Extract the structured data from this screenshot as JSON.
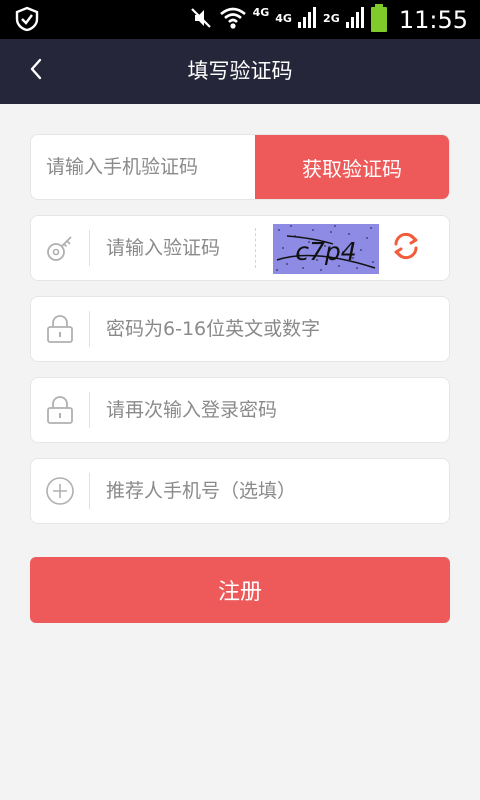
{
  "status_bar": {
    "time": "11:55",
    "net1": "4G",
    "net2": "4G",
    "net3": "2G",
    "icons": [
      "app-shield-icon",
      "mute-icon",
      "wifi-icon",
      "signal-icon",
      "battery-icon"
    ]
  },
  "nav": {
    "back_icon": "chevron-left-icon",
    "title": "填写验证码"
  },
  "form": {
    "sms": {
      "placeholder": "请输入手机验证码",
      "value": "",
      "button_label": "获取验证码"
    },
    "captcha": {
      "placeholder": "请输入验证码",
      "value": "",
      "image_text": "c7p4",
      "icon": "key-icon",
      "refresh_icon": "refresh-icon"
    },
    "password": {
      "placeholder": "密码为6-16位英文或数字",
      "value": "",
      "icon": "lock-icon"
    },
    "password_confirm": {
      "placeholder": "请再次输入登录密码",
      "value": "",
      "icon": "lock-icon"
    },
    "referrer": {
      "placeholder": "推荐人手机号（选填）",
      "value": "",
      "icon": "plus-circle-icon"
    }
  },
  "register_button": {
    "label": "注册"
  },
  "colors": {
    "accent": "#ee5a5a",
    "navbar": "#26263a",
    "background": "#f3f3f3",
    "refresh": "#f25c3a",
    "captcha_bg": "#8d8be3"
  }
}
